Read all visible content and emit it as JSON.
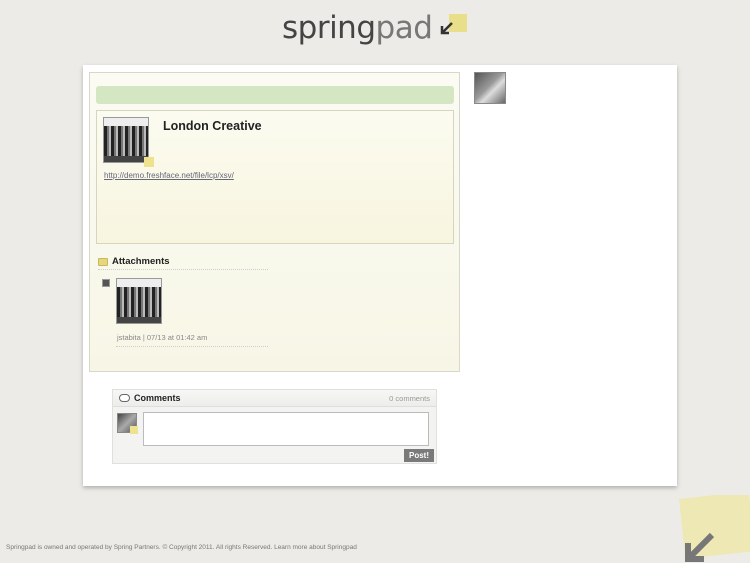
{
  "brand": {
    "logo_spring": "spring",
    "logo_pad": "pad",
    "accent_color": "#e9df8a"
  },
  "item": {
    "title": "London Creative",
    "url": "http://demo.freshface.net/file/lcp/xsv/"
  },
  "attachments": {
    "heading": "Attachments",
    "items": [
      {
        "meta": "jstabita | 07/13 at 01:42 am"
      }
    ]
  },
  "comments": {
    "heading": "Comments",
    "count": "0 comments",
    "input_value": "",
    "post_label": "Post!"
  },
  "footer": {
    "text": "Springpad is owned and operated by Spring Partners. © Copyright 2011. All rights Reserved.",
    "link": "Learn more about Springpad"
  },
  "icons": {
    "logo_mark": "logo-arrow-icon",
    "attachments": "folder-icon",
    "comments": "speech-bubble-icon"
  }
}
